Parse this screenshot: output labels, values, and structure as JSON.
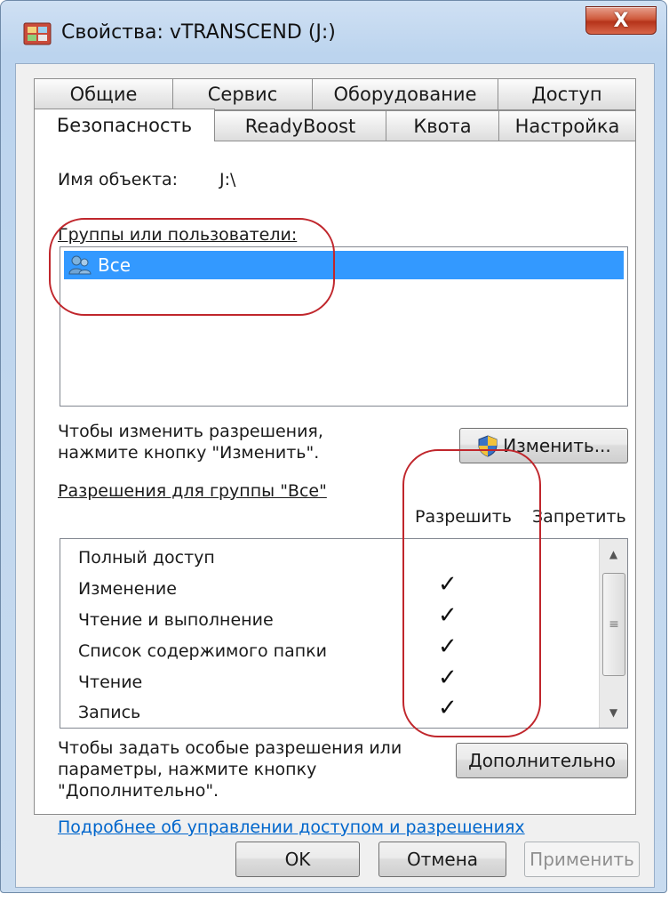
{
  "window": {
    "title": "Свойства: vTRANSCEND (J:)",
    "close_label": "X"
  },
  "tabs_row1": [
    "Общие",
    "Сервис",
    "Оборудование",
    "Доступ"
  ],
  "tabs_row2": [
    "Безопасность",
    "ReadyBoost",
    "Квота",
    "Настройка"
  ],
  "active_tab": "Безопасность",
  "security": {
    "object_label": "Имя объекта:",
    "object_value": "J:\\",
    "groups_label": "Группы или пользователи:",
    "groups": [
      {
        "name": "Все",
        "icon": "users-icon",
        "selected": true
      }
    ],
    "change_hint": "Чтобы изменить разрешения,\nнажмите кнопку \"Изменить\".",
    "change_button": "Изменить...",
    "perms_label": "Разрешения для группы \"Все\"",
    "col_allow": "Разрешить",
    "col_deny": "Запретить",
    "permissions": [
      {
        "name": "Полный доступ",
        "allow": "",
        "deny": ""
      },
      {
        "name": "Изменение",
        "allow": "✓",
        "deny": ""
      },
      {
        "name": "Чтение и выполнение",
        "allow": "✓",
        "deny": ""
      },
      {
        "name": "Список содержимого папки",
        "allow": "✓",
        "deny": ""
      },
      {
        "name": "Чтение",
        "allow": "✓",
        "deny": ""
      },
      {
        "name": "Запись",
        "allow": "✓",
        "deny": ""
      }
    ],
    "advanced_hint": "Чтобы задать особые разрешения или\nпараметры, нажмите кнопку\n\"Дополнительно\".",
    "advanced_button": "Дополнительно",
    "help_link": "Подробнее об управлении доступом и разрешениях"
  },
  "footer": {
    "ok": "OK",
    "cancel": "Отмена",
    "apply": "Применить"
  },
  "colors": {
    "selection": "#3399ff",
    "link": "#0066cc",
    "annotation": "#c0262c"
  }
}
